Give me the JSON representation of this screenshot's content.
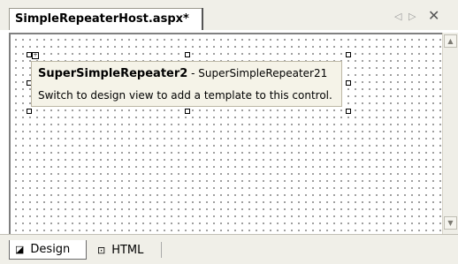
{
  "document_tab": {
    "title": "SimpleRepeaterHost.aspx*"
  },
  "tab_nav": {
    "left_arrow": "◁",
    "right_arrow": "▷",
    "close": "✕"
  },
  "control": {
    "name": "SuperSimpleRepeater2",
    "separator": " - ",
    "id": "SuperSimpleRepeater21",
    "message": "Switch to design view to add a template to this control."
  },
  "view_tabs": [
    {
      "label": "Design",
      "icon": "design-view-icon",
      "selected": true
    },
    {
      "label": "HTML",
      "icon": "html-view-icon",
      "selected": false
    }
  ],
  "colors": {
    "tab_background": "#f0efe8",
    "editor_grid_dot": "#7f7f7f",
    "control_box_background": "#f5f3e8"
  }
}
